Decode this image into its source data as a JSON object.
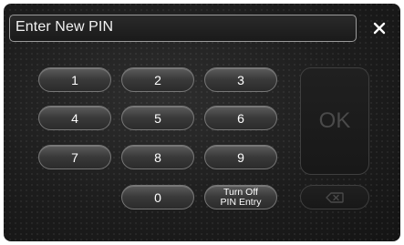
{
  "header": {
    "title": "Enter New PIN"
  },
  "keypad": {
    "k1": "1",
    "k2": "2",
    "k3": "3",
    "k4": "4",
    "k5": "5",
    "k6": "6",
    "k7": "7",
    "k8": "8",
    "k9": "9",
    "k0": "0",
    "turn_off_line1": "Turn Off",
    "turn_off_line2": "PIN Entry"
  },
  "actions": {
    "ok_label": "OK"
  },
  "icons": {
    "close": "close-icon",
    "backspace": "backspace-icon"
  },
  "colors": {
    "background": "#1d1d1d",
    "key": "#4a4a4a",
    "disabled": "#4a4a4a",
    "text": "#ffffff"
  }
}
